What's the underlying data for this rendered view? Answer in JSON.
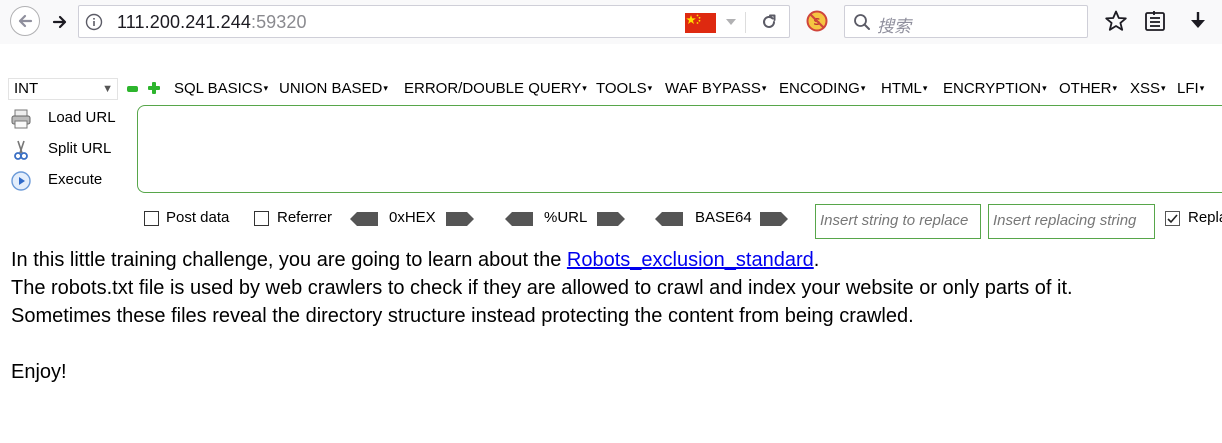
{
  "browser": {
    "url_host": "111.200.241.244",
    "url_port": ":59320",
    "search_placeholder": "搜索",
    "flag_color": "#de2910"
  },
  "hackbar": {
    "type_select": "INT",
    "menus": [
      {
        "label": "SQL BASICS"
      },
      {
        "label": "UNION BASED"
      },
      {
        "label": "ERROR/DOUBLE QUERY"
      },
      {
        "label": "TOOLS"
      },
      {
        "label": "WAF BYPASS"
      },
      {
        "label": "ENCODING"
      },
      {
        "label": "HTML"
      },
      {
        "label": "ENCRYPTION"
      },
      {
        "label": "OTHER"
      },
      {
        "label": "XSS"
      },
      {
        "label": "LFI"
      }
    ],
    "actions": {
      "load_url": "Load URL",
      "split_url": "Split URL",
      "execute": "Execute"
    },
    "url_value": "",
    "options": {
      "post_data": "Post data",
      "referrer": "Referrer",
      "hex": "0xHEX",
      "url": "%URL",
      "base64": "BASE64",
      "insert_placeholder": "Insert string to replace",
      "replacing_placeholder": "Insert replacing string",
      "replace_all": "Replace All",
      "accent_color": "#57a64a"
    }
  },
  "page": {
    "line1_before": "In this little training challenge, you are going to learn about the ",
    "line1_link": "Robots_exclusion_standard",
    "line1_after": ".",
    "line2": "The robots.txt file is used by web crawlers to check if they are allowed to crawl and index your website or only parts of it.",
    "line3": "Sometimes these files reveal the directory structure instead protecting the content from being crawled.",
    "line4": "Enjoy!"
  }
}
